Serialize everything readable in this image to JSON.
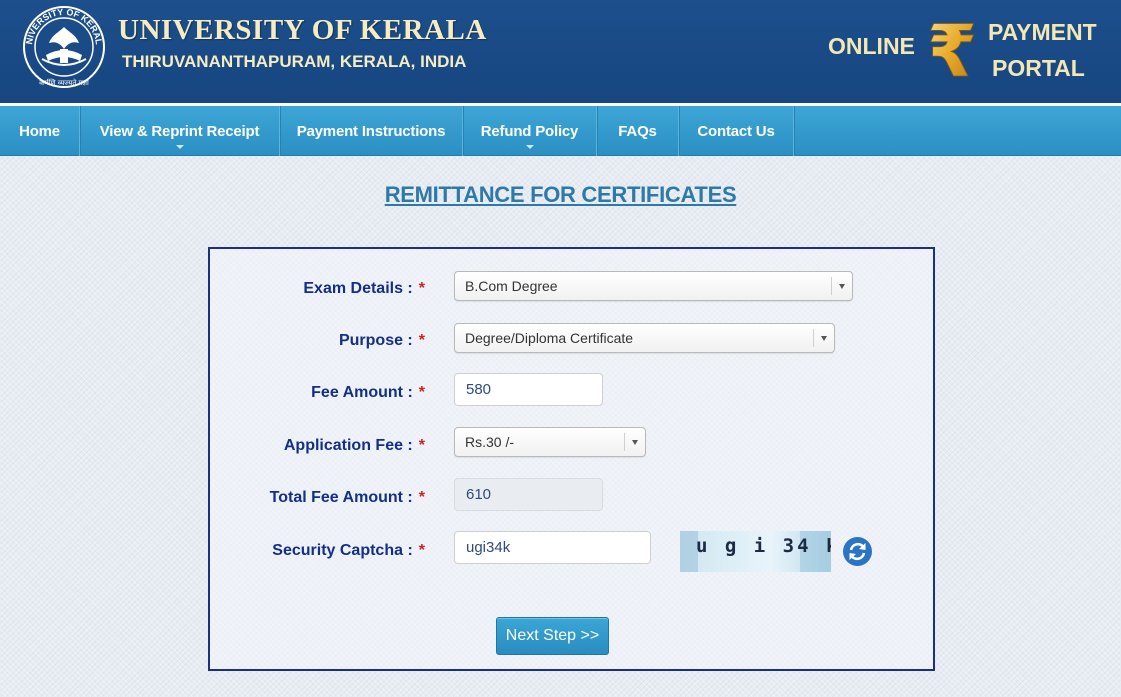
{
  "header": {
    "title": "UNIVERSITY OF KERALA",
    "subtitle": "THIRUVANANTHAPURAM, KERALA, INDIA",
    "logo_ring_text": "UNIVERSITY OF KERALA",
    "logo_motto": "कर्मणि व्यज्यते प्रज्ञा",
    "portal_online": "ONLINE",
    "portal_payment": "PAYMENT",
    "portal_portal": "PORTAL",
    "rupee_symbol": "₹"
  },
  "nav": {
    "items": [
      {
        "label": "Home",
        "has_dropdown": false
      },
      {
        "label": "View & Reprint Receipt",
        "has_dropdown": true
      },
      {
        "label": "Payment Instructions",
        "has_dropdown": false
      },
      {
        "label": "Refund Policy",
        "has_dropdown": true
      },
      {
        "label": "FAQs",
        "has_dropdown": false
      },
      {
        "label": "Contact Us",
        "has_dropdown": false
      }
    ]
  },
  "page": {
    "title": "REMITTANCE FOR CERTIFICATES"
  },
  "form": {
    "required_marker": "*",
    "exam_details": {
      "label": "Exam Details :",
      "value": "B.Com Degree"
    },
    "purpose": {
      "label": "Purpose :",
      "value": "Degree/Diploma Certificate"
    },
    "fee_amount": {
      "label": "Fee Amount :",
      "value": "580"
    },
    "application_fee": {
      "label": "Application Fee :",
      "value": "Rs.30 /-"
    },
    "total_fee": {
      "label": "Total Fee Amount :",
      "value": "610"
    },
    "captcha": {
      "label": "Security Captcha :",
      "value": "ugi34k",
      "image_text": "u g i 34 k"
    },
    "next_button": "Next Step >>"
  },
  "colors": {
    "header_bg": "#1a4b87",
    "nav_bg": "#3ea6d6",
    "label_text": "#142f86",
    "required": "#d12020",
    "title_text": "#2f79a8",
    "button_bg": "#2a8cc0"
  }
}
